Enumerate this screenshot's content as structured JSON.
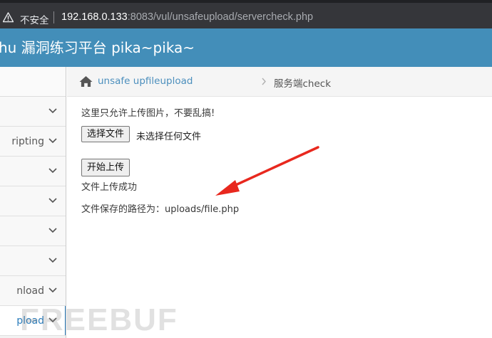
{
  "browser": {
    "insecure_label": "不安全",
    "url_host": "192.168.0.133",
    "url_path": ":8083/vul/unsafeupload/servercheck.php"
  },
  "header": {
    "title": "hu 漏洞练习平台 pika~pika~"
  },
  "sidebar": {
    "items": [
      {
        "label": ""
      },
      {
        "label": "ripting"
      },
      {
        "label": ""
      },
      {
        "label": ""
      },
      {
        "label": ""
      },
      {
        "label": ""
      },
      {
        "label": "nload"
      },
      {
        "label": "pload"
      }
    ]
  },
  "breadcrumb": {
    "link": "unsafe upfileupload",
    "current": "服务端check"
  },
  "main": {
    "hint": "这里只允许上传图片，不要乱搞!",
    "file_button": "选择文件",
    "no_file": "未选择任何文件",
    "upload_button": "开始上传",
    "success": "文件上传成功",
    "path_message": "文件保存的路径为：uploads/file.php"
  },
  "watermark": "FREEBUF",
  "colors": {
    "header": "#438eb9",
    "link": "#4c8fbd",
    "arrow": "#e8281e"
  }
}
